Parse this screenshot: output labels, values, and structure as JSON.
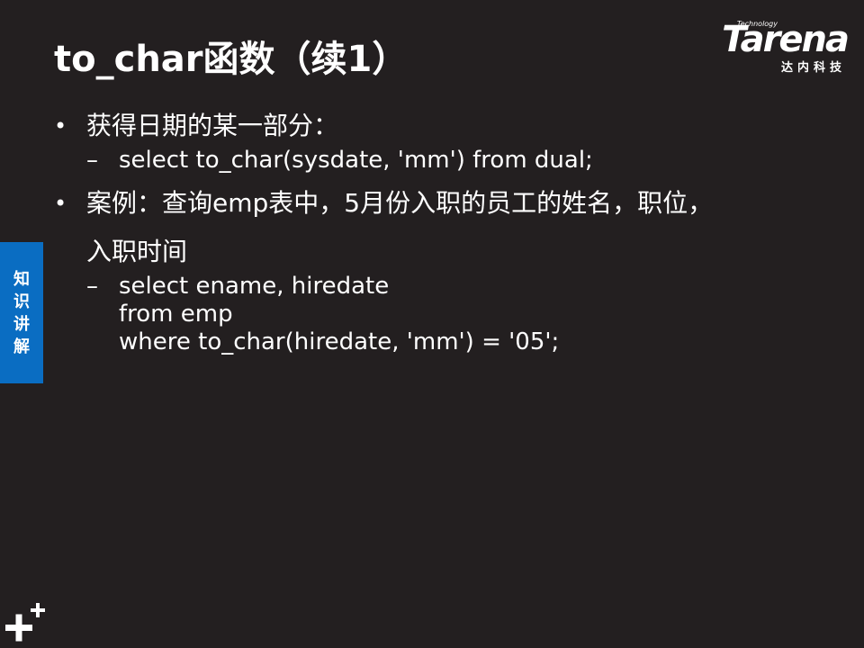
{
  "slide": {
    "title": "to_char函数（续1）"
  },
  "logo": {
    "technology": "Technology",
    "brand": "Tarena",
    "cn": "达内科技"
  },
  "content": {
    "bullet1": {
      "text": "获得日期的某一部分：",
      "sub": "select to_char(sysdate, 'mm')  from dual;"
    },
    "bullet2": {
      "text_line1": "案例：查询emp表中，5月份入职的员工的姓名，职位，",
      "text_line2": "入职时间",
      "sub_lines": [
        "select ename, hiredate",
        "from emp",
        "where to_char(hiredate, 'mm')  = '05';"
      ]
    },
    "dash": "–"
  },
  "side_tab": {
    "chars": [
      "知",
      "识",
      "讲",
      "解"
    ],
    "color": "#0a6dc2"
  },
  "colors": {
    "background": "#231f20",
    "text": "#ffffff"
  }
}
